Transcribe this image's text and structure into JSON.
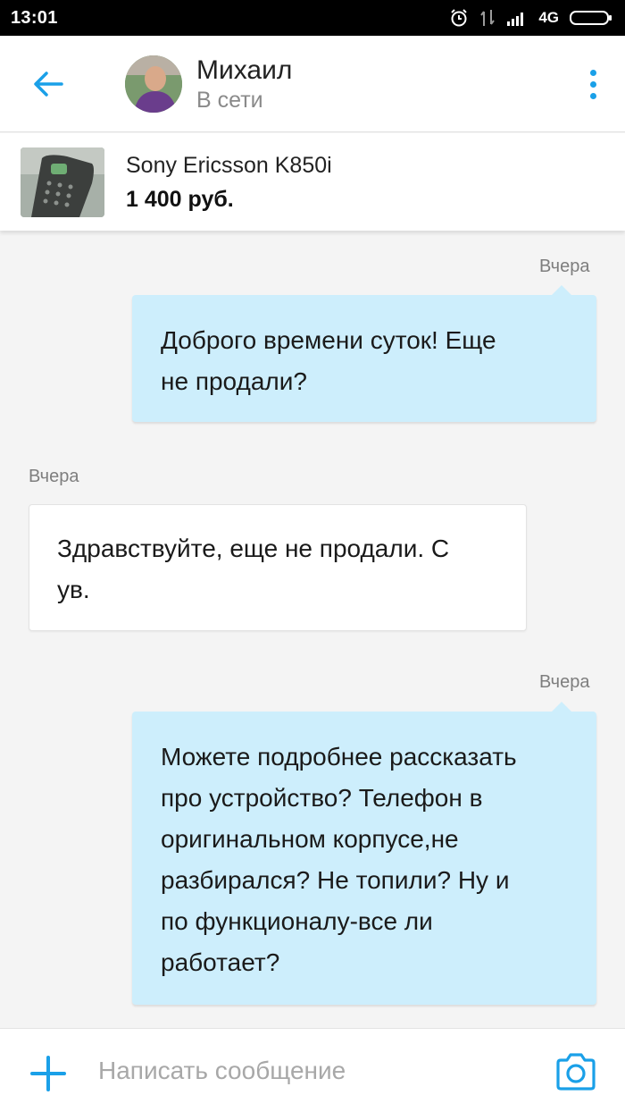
{
  "status_bar": {
    "time": "13:01",
    "network": "4G",
    "icons": [
      "alarm-icon",
      "data-arrows-icon",
      "signal-icon",
      "battery-icon"
    ]
  },
  "header": {
    "back_icon": "arrow-left-icon",
    "name": "Михаил",
    "status": "В сети",
    "menu_icon": "more-vertical-icon"
  },
  "product": {
    "title": "Sony Ericsson K850i",
    "price": "1 400 руб."
  },
  "messages": [
    {
      "direction": "out",
      "time": "Вчера",
      "lines": [
        "Доброго времени суток! Еще",
        "не продали?"
      ]
    },
    {
      "direction": "in",
      "time": "Вчера",
      "lines": [
        "Здравствуйте, еще не продали. С",
        "ув."
      ]
    },
    {
      "direction": "out",
      "time": "Вчера",
      "lines": [
        "Можете подробнее рассказать",
        "про устройство? Телефон в",
        "оригинальном корпусе,не",
        "разбирался? Не топили? Ну и",
        "по функционалу-все ли",
        "работает?"
      ]
    }
  ],
  "input": {
    "placeholder": "Написать сообщение",
    "value": "",
    "add_icon": "plus-icon",
    "camera_icon": "camera-icon"
  },
  "colors": {
    "accent": "#1aa0e8",
    "outgoing_bubble": "#cdeefc",
    "incoming_bubble": "#ffffff",
    "background": "#f4f4f4"
  }
}
